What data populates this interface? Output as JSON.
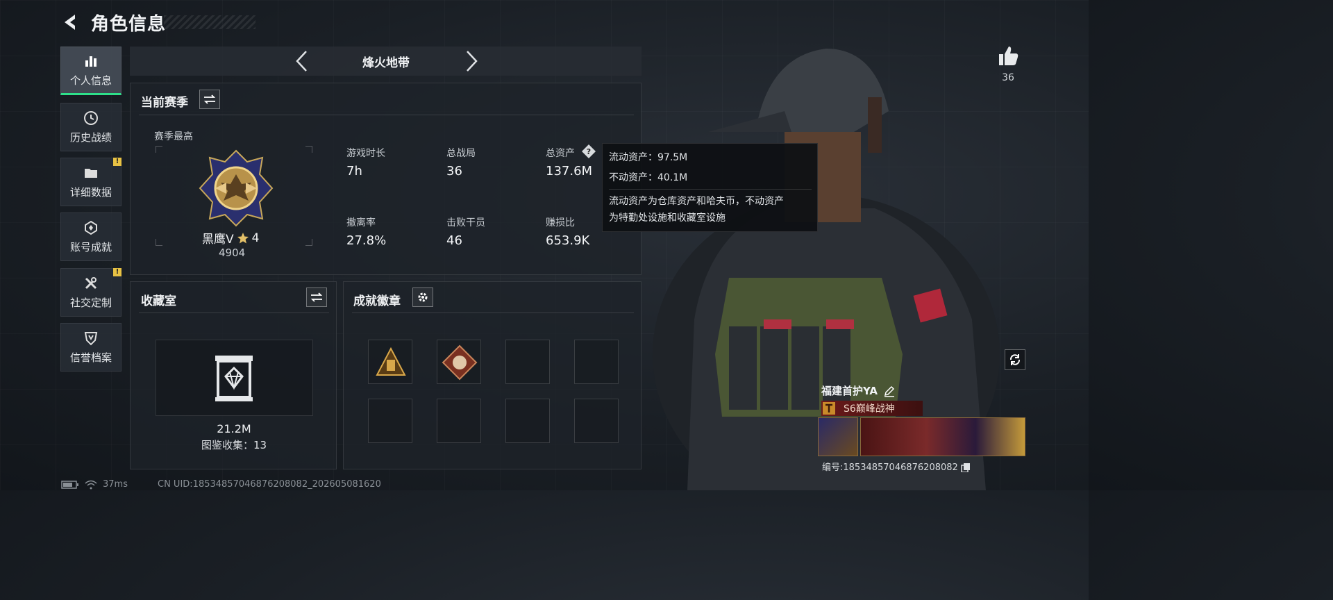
{
  "header": {
    "title": "角色信息"
  },
  "nav": {
    "items": [
      {
        "label": "个人信息",
        "icon": "bar-chart-icon",
        "active": true,
        "alert": false
      },
      {
        "label": "历史战绩",
        "icon": "clock-icon",
        "active": false,
        "alert": false
      },
      {
        "label": "详细数据",
        "icon": "folder-icon",
        "active": false,
        "alert": true
      },
      {
        "label": "账号成就",
        "icon": "medal-icon",
        "active": false,
        "alert": false
      },
      {
        "label": "社交定制",
        "icon": "wrench-icon",
        "active": false,
        "alert": true
      },
      {
        "label": "信誉档案",
        "icon": "shield-icon",
        "active": false,
        "alert": false
      }
    ],
    "alert_mark": "!"
  },
  "mode": {
    "label": "烽火地带"
  },
  "season": {
    "title": "当前赛季",
    "best_label": "赛季最高",
    "rank_name": "黑鹰V",
    "rank_stars": "4",
    "rank_score": "4904",
    "stats": [
      {
        "label": "游戏时长",
        "value": "7h"
      },
      {
        "label": "总战局",
        "value": "36"
      },
      {
        "label": "总资产",
        "value": "137.6M"
      },
      {
        "label": "撤离率",
        "value": "27.8%"
      },
      {
        "label": "击败干员",
        "value": "46"
      },
      {
        "label": "赚损比",
        "value": "653.9K"
      }
    ]
  },
  "tooltip": {
    "liquid": "流动资产：97.5M",
    "fixed": "不动资产：40.1M",
    "desc_line1": "流动资产为仓库资产和哈夫币，不动资产",
    "desc_line2": "为特勤处设施和收藏室设施"
  },
  "collection": {
    "title": "收藏室",
    "value": "21.2M",
    "count_label": "图鉴收集：13"
  },
  "badges": {
    "title": "成就徽章"
  },
  "profile": {
    "likes": "36",
    "name": "福建首护YA",
    "title_tag": "S6巅峰战神",
    "id_label": "编号:1853485704687620808​2"
  },
  "footer": {
    "ping": "37ms",
    "uid": "CN UID:18534857046876208082_202605081620"
  },
  "colors": {
    "accent_green": "#2ee08a",
    "alert_yellow": "#e8c244",
    "title_red": "#6b1a1a"
  }
}
